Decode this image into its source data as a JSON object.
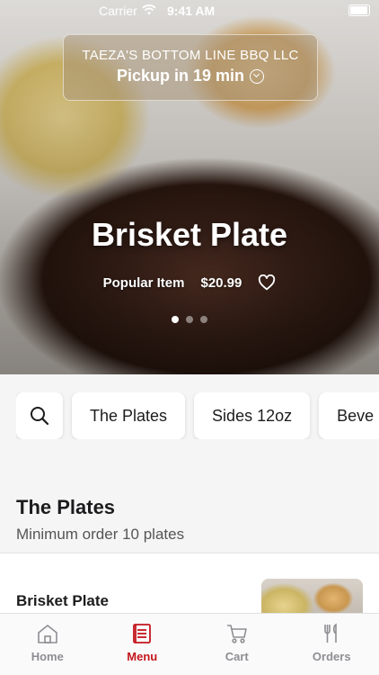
{
  "status_bar": {
    "carrier": "Carrier",
    "time": "9:41 AM"
  },
  "pickup": {
    "restaurant": "TAEZA'S BOTTOM LINE BBQ LLC",
    "eta": "Pickup in 19 min"
  },
  "hero": {
    "title": "Brisket Plate",
    "tag": "Popular Item",
    "price": "$20.99",
    "carousel_count": 3,
    "carousel_active": 1
  },
  "categories": {
    "items": [
      "The Plates",
      "Sides 12oz",
      "Beve"
    ]
  },
  "section": {
    "title": "The Plates",
    "subtitle": "Minimum order 10 plates"
  },
  "item": {
    "name": "Brisket Plate"
  },
  "tabbar": {
    "home": "Home",
    "menu": "Menu",
    "cart": "Cart",
    "orders": "Orders"
  },
  "colors": {
    "accent": "#c4161c"
  }
}
